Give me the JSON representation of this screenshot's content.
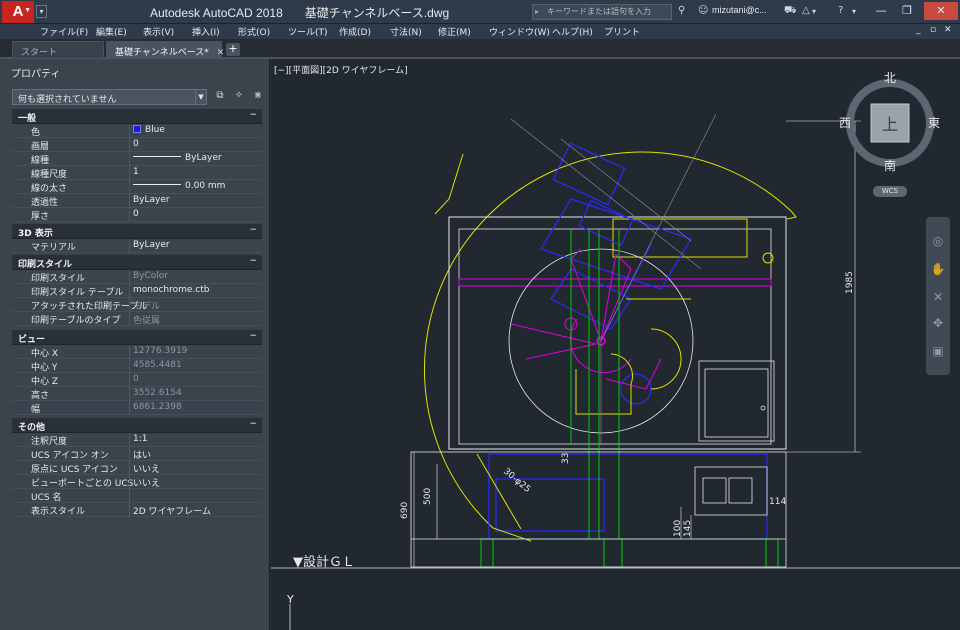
{
  "titlebar": {
    "app_button": "A",
    "app_name": "Autodesk AutoCAD 2018",
    "document": "基礎チャンネルベース.dwg",
    "search_placeholder": "キーワードまたは語句を入力",
    "user": "mizutani@c..."
  },
  "menu": [
    "ファイル(F)",
    "編集(E)",
    "表示(V)",
    "挿入(I)",
    "形式(O)",
    "ツール(T)",
    "作成(D)",
    "寸法(N)",
    "修正(M)",
    "ウィンドウ(W)",
    "ヘルプ(H)",
    "プリント"
  ],
  "tabs": [
    {
      "label": "スタート"
    },
    {
      "label": "基礎チャンネルベース*"
    }
  ],
  "palette": {
    "title": "プロパティ",
    "selection": "何も選択されていません",
    "sections": {
      "general": "一般",
      "threed": "3D 表示",
      "plot": "印刷スタイル",
      "view": "ビュー",
      "misc": "その他"
    },
    "general": [
      {
        "name": "色",
        "value": "Blue"
      },
      {
        "name": "画層",
        "value": "0"
      },
      {
        "name": "線種",
        "value": "ByLayer"
      },
      {
        "name": "線種尺度",
        "value": "1"
      },
      {
        "name": "線の太さ",
        "value": "0.00 mm"
      },
      {
        "name": "透過性",
        "value": "ByLayer"
      },
      {
        "name": "厚さ",
        "value": "0"
      }
    ],
    "threed": [
      {
        "name": "マテリアル",
        "value": "ByLayer"
      }
    ],
    "plot": [
      {
        "name": "印刷スタイル",
        "value": "ByColor"
      },
      {
        "name": "印刷スタイル テーブル",
        "value": "monochrome.ctb"
      },
      {
        "name": "アタッチされた印刷テーブル",
        "value": "モデル"
      },
      {
        "name": "印刷テーブルのタイプ",
        "value": "色従属"
      }
    ],
    "view": [
      {
        "name": "中心 X",
        "value": "12776.3919"
      },
      {
        "name": "中心 Y",
        "value": "4585.4481"
      },
      {
        "name": "中心 Z",
        "value": "0"
      },
      {
        "name": "高さ",
        "value": "3552.6154"
      },
      {
        "name": "幅",
        "value": "6861.2398"
      }
    ],
    "misc": [
      {
        "name": "注釈尺度",
        "value": "1:1"
      },
      {
        "name": "UCS アイコン オン",
        "value": "はい"
      },
      {
        "name": "原点に UCS アイコン",
        "value": "いいえ"
      },
      {
        "name": "ビューポートごとの UCS",
        "value": "いいえ"
      },
      {
        "name": "UCS 名",
        "value": ""
      },
      {
        "name": "表示スタイル",
        "value": "2D ワイヤフレーム"
      }
    ]
  },
  "viewport": {
    "label": "[−][平面図][2D ワイヤフレーム]",
    "viewcube": {
      "face": "上",
      "north": "北",
      "south": "南",
      "east": "東",
      "west": "西",
      "ucs": "WCS"
    },
    "dims": {
      "height": "1985",
      "base": "690",
      "inner": "500",
      "d33": "33",
      "d114": "114",
      "d100": "100",
      "d145": "145",
      "angle": "30-φ25"
    },
    "ground_label": "▼設計ＧＬ",
    "ucs_axis": "Y"
  },
  "colors": {
    "accent": "#c8251e",
    "canvas": "#212830",
    "yellow": "#e0e000",
    "blue": "#2a2aff",
    "green": "#00d000",
    "magenta": "#e000e0",
    "white": "#e8e8e8"
  }
}
